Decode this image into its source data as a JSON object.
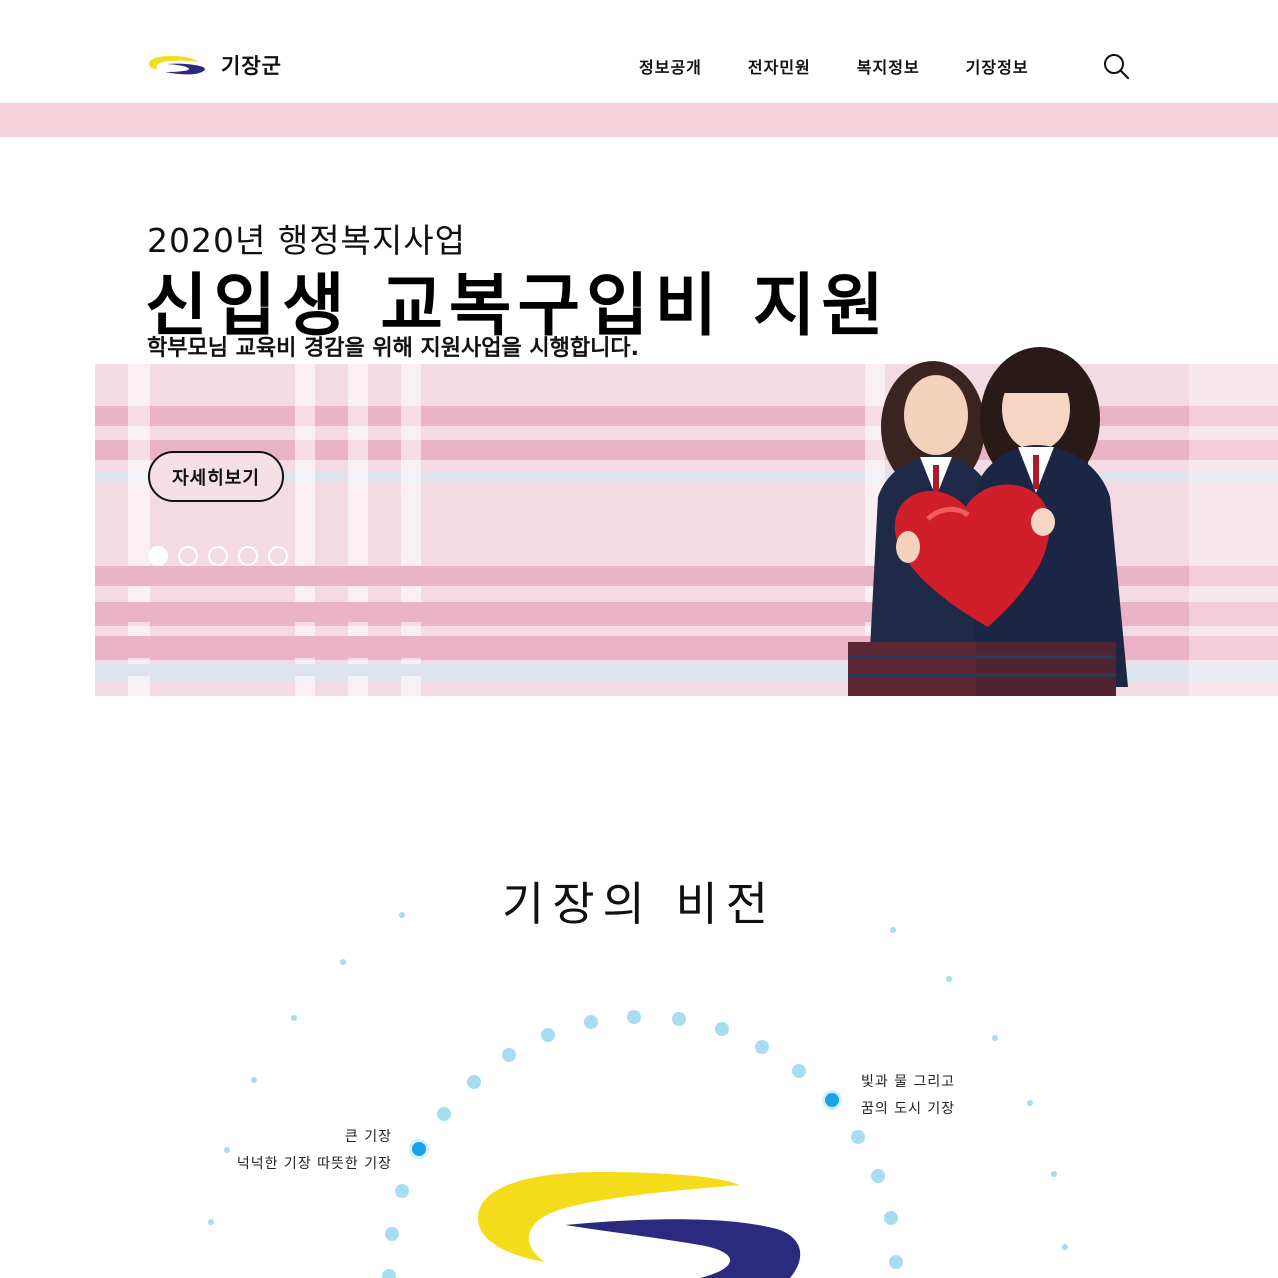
{
  "header": {
    "logo_text": "기장군",
    "nav": [
      "정보공개",
      "전자민원",
      "복지정보",
      "기장정보"
    ],
    "search_icon": "search-icon"
  },
  "hero": {
    "subtitle": "2020년 행정복지사업",
    "title": "신입생 교복구입비 지원",
    "description": "학부모님 교육비 경감을 위해 지원사업을 시행합니다.",
    "more_button": "자세히보기",
    "slide_count": 5,
    "active_slide": 1
  },
  "vision": {
    "title": "기장의 비전",
    "left_line1": "큰 기장",
    "left_line2": "넉넉한 기장 따뜻한 기장",
    "right_line1": "빛과 물 그리고",
    "right_line2": "꿈의 도시 기장"
  },
  "colors": {
    "strip": "#f3d2dc",
    "hero_pink": "#f4dbe3",
    "hero_stripe": "#ebb4c6",
    "dot_light": "#a8dcf0",
    "dot_accent": "#1aa3e8",
    "logo_yellow": "#f5dc1a",
    "logo_navy": "#2b2a7f"
  }
}
